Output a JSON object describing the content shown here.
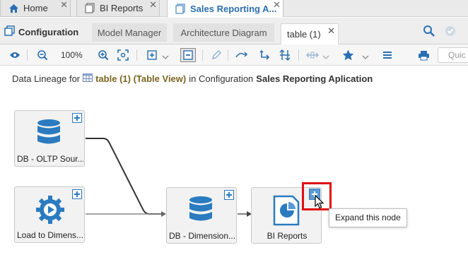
{
  "top_tabs": [
    {
      "label": "Home",
      "icon": "home-icon",
      "close": "✕"
    },
    {
      "label": "BI Reports",
      "icon": "document-icon",
      "close": "✕"
    },
    {
      "label": "Sales Reporting A...",
      "icon": "document-icon",
      "close": "✕"
    }
  ],
  "config_title": "Configuration",
  "sub_tabs": [
    {
      "label": "Model Manager"
    },
    {
      "label": "Architecture Diagram"
    },
    {
      "label": "table (1)",
      "close": "✕"
    }
  ],
  "toolbar": {
    "zoom": "100%",
    "quick_search_placeholder": "Quic"
  },
  "heading": {
    "prefix": "Data Lineage for",
    "object": "table (1) (Table View)",
    "middle": "in Configuration",
    "app": "Sales Reporting Aplication"
  },
  "nodes": [
    {
      "label": "DB - OLTP Sour...",
      "icon": "database-icon"
    },
    {
      "label": "Load to Dimens...",
      "icon": "gear-play-icon"
    },
    {
      "label": "DB - Dimension...",
      "icon": "database-icon"
    },
    {
      "label": "BI Reports",
      "icon": "report-icon"
    }
  ],
  "tooltip": "Expand this node",
  "colors": {
    "accent": "#2a7bc0",
    "highlight": "#e01010",
    "object_name": "#7a6520"
  }
}
